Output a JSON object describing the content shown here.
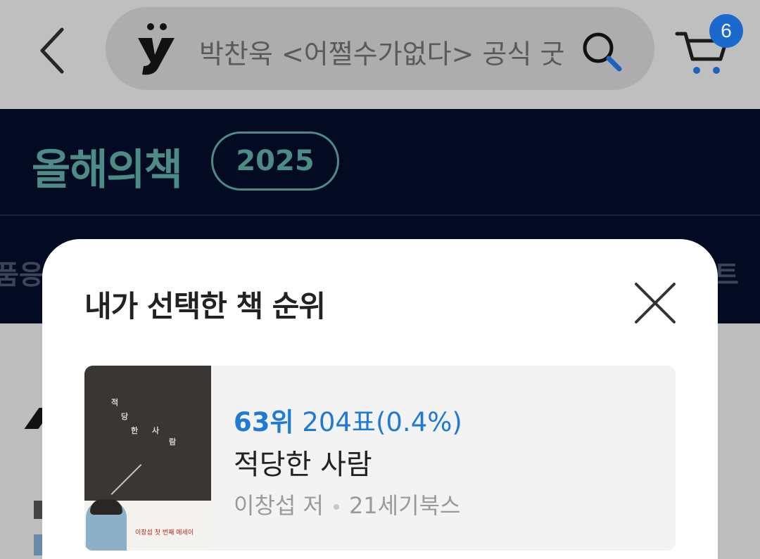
{
  "header": {
    "search_text": "박찬욱 <어쩔수가없다> 공식 굿",
    "cart_count": "6"
  },
  "banner": {
    "title": "올해의책",
    "year": "2025",
    "tab_left": "품응",
    "tab_right": "트"
  },
  "modal": {
    "title": "내가 선택한 책 순위",
    "book": {
      "rank": "63위",
      "votes": "204표(0.4%)",
      "title": "적당한 사람",
      "author": "이창섭 저",
      "publisher": "21세기북스",
      "cover_text": {
        "t1": "적",
        "t2": "당",
        "t3": "한",
        "t4": "사",
        "t5": "람",
        "subtitle": "이창섭 첫 번째 에세이"
      }
    }
  },
  "colors": {
    "accent": "#1f7ad6",
    "banner_bg": "#030b23",
    "banner_teal": "#4c8b86"
  }
}
